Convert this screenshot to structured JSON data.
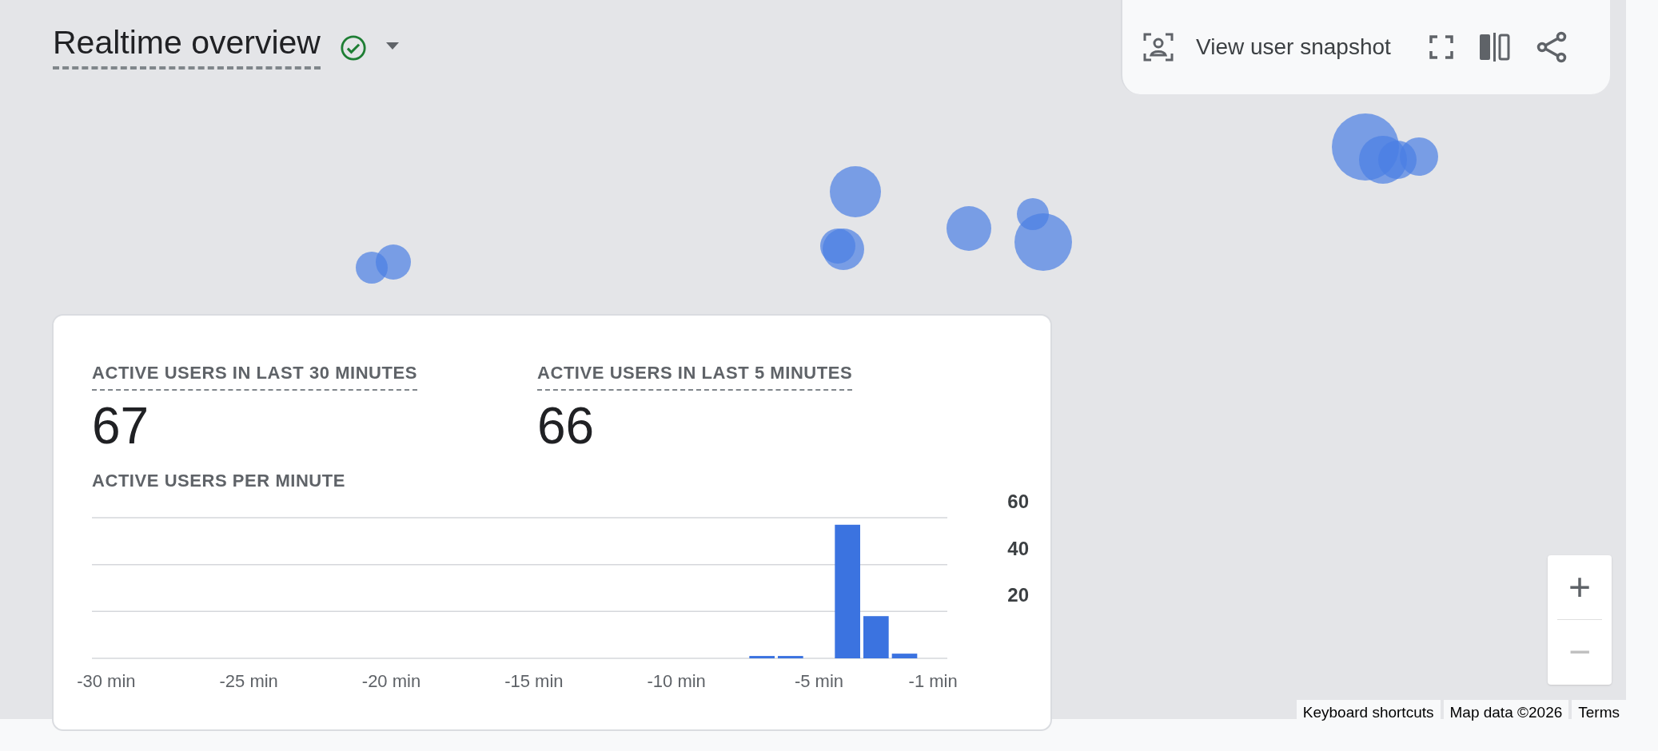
{
  "header": {
    "title": "Realtime overview"
  },
  "toolbar": {
    "snapshot_button": "View user snapshot"
  },
  "card": {
    "metrics": [
      {
        "label": "ACTIVE USERS IN LAST 30 MINUTES",
        "value": "67"
      },
      {
        "label": "ACTIVE USERS IN LAST 5 MINUTES",
        "value": "66"
      }
    ],
    "chart_title": "ACTIVE USERS PER MINUTE",
    "chart_data": {
      "type": "bar",
      "x": [
        -30,
        -29,
        -28,
        -27,
        -26,
        -25,
        -24,
        -23,
        -22,
        -21,
        -20,
        -19,
        -18,
        -17,
        -16,
        -15,
        -14,
        -13,
        -12,
        -11,
        -10,
        -9,
        -8,
        -7,
        -6,
        -5,
        -4,
        -3,
        -2,
        -1
      ],
      "series": [
        {
          "color": "#3b73e0",
          "values": [
            0,
            0,
            0,
            0,
            0,
            0,
            0,
            0,
            0,
            0,
            0,
            0,
            0,
            0,
            0,
            0,
            0,
            0,
            0,
            0,
            0,
            0,
            0,
            1,
            1,
            0,
            57,
            18,
            2,
            0
          ]
        }
      ],
      "xlim": [
        -30.5,
        -0.5
      ],
      "ylim": [
        0,
        60
      ],
      "yticks": [
        20,
        40,
        60
      ],
      "xticks": [
        {
          "value": -30,
          "label": "-30 min"
        },
        {
          "value": -25,
          "label": "-25 min"
        },
        {
          "value": -20,
          "label": "-20 min"
        },
        {
          "value": -15,
          "label": "-15 min"
        },
        {
          "value": -10,
          "label": "-10 min"
        },
        {
          "value": -5,
          "label": "-5 min"
        },
        {
          "value": -1,
          "label": "-1 min"
        }
      ]
    }
  },
  "zoom_controls": {
    "zoom_in": "+",
    "zoom_out": "−"
  },
  "footer": [
    "Keyboard shortcuts",
    "Map data ©2026",
    "Terms"
  ]
}
